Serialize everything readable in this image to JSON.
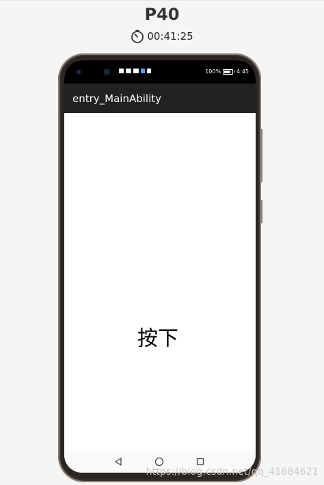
{
  "header": {
    "device_name": "P40",
    "elapsed_time": "00:41:25"
  },
  "phone": {
    "status_bar": {
      "battery_percent": "100%",
      "time": "4:45"
    },
    "app_bar": {
      "title": "entry_MainAbility"
    },
    "content": {
      "text": "按下"
    },
    "nav_bar": {
      "back_icon": "triangle-back-icon",
      "home_icon": "circle-home-icon",
      "recent_icon": "square-recent-icon"
    }
  },
  "watermark": "https://blog.csdn.net/qq_41684621",
  "colors": {
    "app_bar": "#212121",
    "status_bar": "#000000",
    "page_background": "#f5f5f5"
  }
}
